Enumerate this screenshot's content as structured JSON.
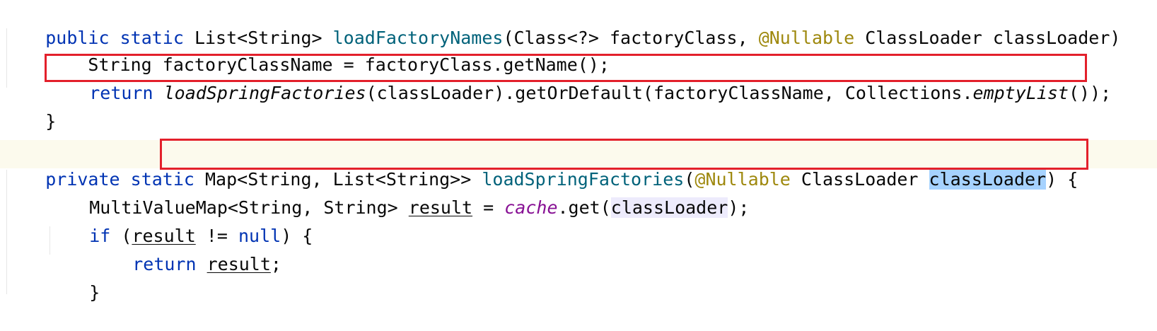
{
  "editor": {
    "line1": {
      "t1": "public",
      "t2": " ",
      "t3": "static",
      "t4": " List<String> ",
      "t5": "loadFactoryNames",
      "t6": "(Class<?> factoryClass, ",
      "t7": "@Nullable",
      "t8": " ClassLoader classLoader)"
    },
    "line2": {
      "t1": "    String factoryClassName = factoryClass.getName();"
    },
    "line3": {
      "t1": "return",
      "t2": " ",
      "t3": "loadSpringFactories",
      "t4": "(classLoader).getOrDefault(factoryClassName, Collections.",
      "t5": "emptyList",
      "t6": "());"
    },
    "line4": {
      "t1": "}"
    },
    "line6": {
      "t1": "private",
      "t2": " ",
      "t3": "static",
      "t4": " Map<String, List<String>> ",
      "t5": "loadSpringFactories",
      "t6": "(",
      "t7": "@Nullable",
      "t8": " ClassLoader ",
      "t9": "classLoader",
      "t10": ") {"
    },
    "line7": {
      "t1": "MultiValueMap<String, String> ",
      "t2": "result",
      "t3": " = ",
      "t4": "cache",
      "t5": ".get(",
      "t6": "classLoader",
      "t7": ");"
    },
    "line8": {
      "t1": "if",
      "t2": " (",
      "t3": "result",
      "t4": " != ",
      "t5": "null",
      "t6": ") {"
    },
    "line9": {
      "t1": "return",
      "t2": " ",
      "t3": "result",
      "t4": ";"
    },
    "line10": {
      "t1": "}"
    }
  },
  "colors": {
    "keyword": "#0033b3",
    "method": "#00627a",
    "annotation": "#9e880d",
    "static_field": "#871094",
    "highlight_box": "#e3202b",
    "selection": "#a6d2ff"
  }
}
